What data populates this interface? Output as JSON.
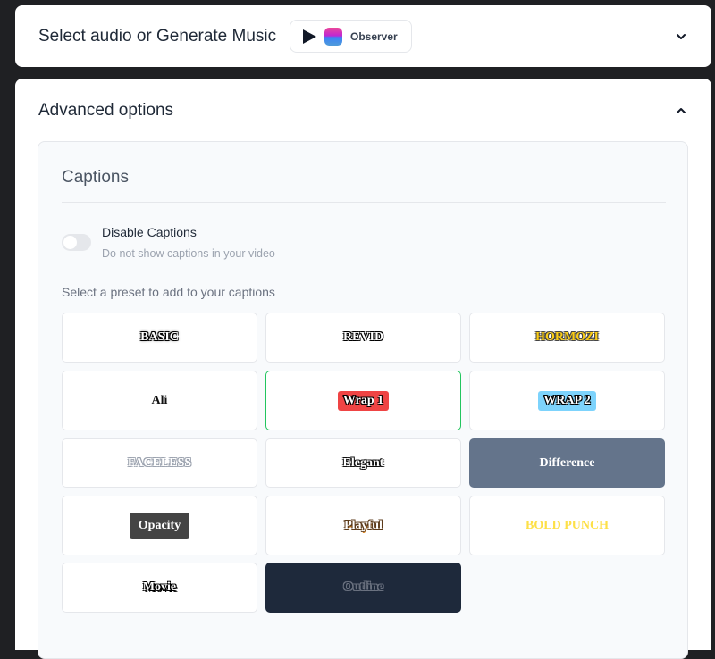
{
  "audio_section": {
    "title": "Select audio or Generate Music",
    "voice_name": "Observer",
    "icons": {
      "play": "play-icon",
      "expand": "chevron-down-icon"
    }
  },
  "advanced_section": {
    "title": "Advanced options",
    "icons": {
      "collapse": "chevron-up-icon"
    },
    "captions": {
      "title": "Captions",
      "disable_toggle": {
        "label": "Disable Captions",
        "description": "Do not show captions in your video",
        "state": "off"
      },
      "preset_hint": "Select a preset to add to your captions",
      "presets": [
        {
          "label": "BASIC"
        },
        {
          "label": "REVID"
        },
        {
          "label": "HORMOZI"
        },
        {
          "label": "Ali"
        },
        {
          "label": "Wrap 1",
          "selected": true
        },
        {
          "label": "WRAP 2"
        },
        {
          "label": "FACELESS"
        },
        {
          "label": "Elegant"
        },
        {
          "label": "Difference"
        },
        {
          "label": "Opacity"
        },
        {
          "label": "Playful"
        },
        {
          "label": "BOLD PUNCH"
        },
        {
          "label": "Movie"
        },
        {
          "label": "Outline"
        }
      ]
    }
  },
  "colors": {
    "page_background": "#1f2023",
    "selected_border": "#22c55e",
    "difference_bg": "#64748b",
    "outline_bg": "#1e293b"
  }
}
